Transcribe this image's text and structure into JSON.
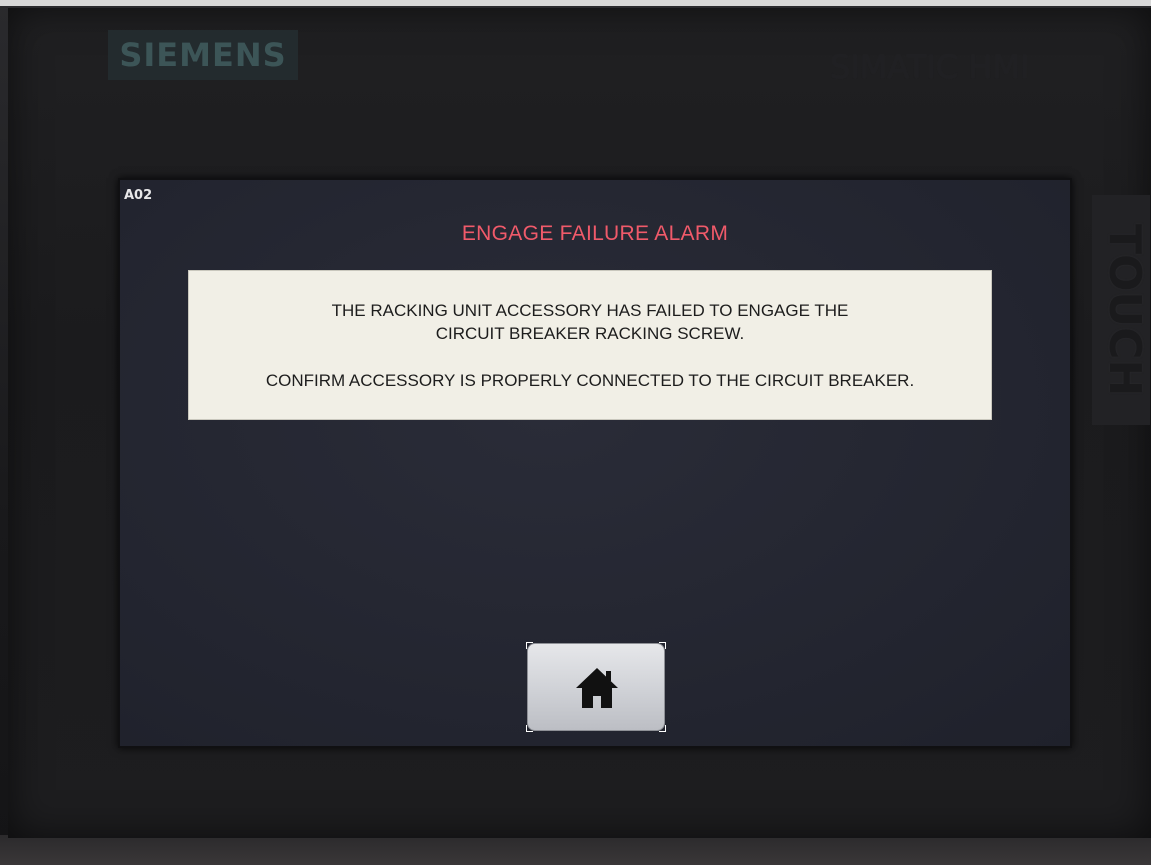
{
  "brand": {
    "left_logo": "SIEMENS",
    "right_logo": "SIMATIC HMI",
    "side_label": "TOUCH"
  },
  "screen": {
    "id": "A02",
    "alarm_title": "ENGAGE FAILURE ALARM",
    "message": {
      "line1": "THE RACKING UNIT ACCESSORY HAS FAILED TO ENGAGE THE",
      "line2": "CIRCUIT BREAKER RACKING SCREW.",
      "line3": "CONFIRM ACCESSORY IS PROPERLY CONNECTED TO THE CIRCUIT BREAKER."
    },
    "colors": {
      "alarm_title": "#f05a6a",
      "message_bg": "#f1efe6",
      "screen_bg": "#242631"
    }
  },
  "home_button": {
    "icon": "home-icon"
  }
}
